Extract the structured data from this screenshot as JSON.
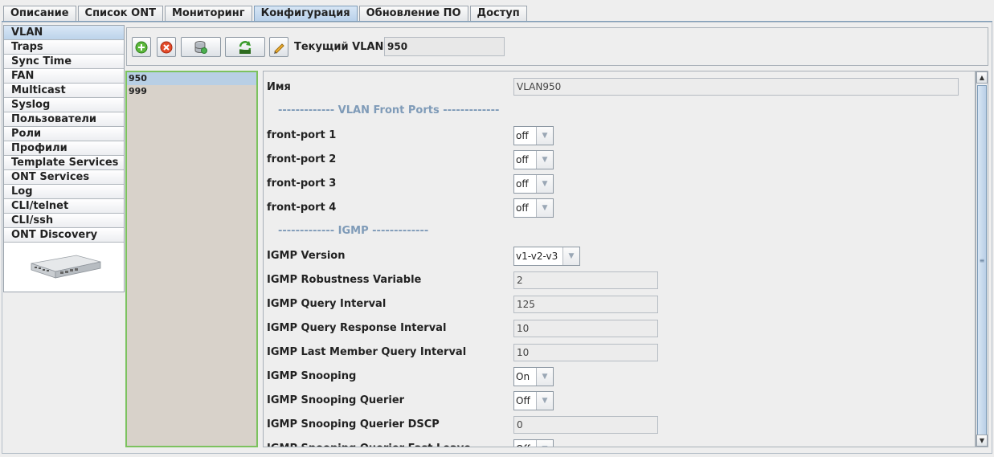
{
  "tabs": [
    {
      "label": "Описание"
    },
    {
      "label": "Список ONT"
    },
    {
      "label": "Мониторинг"
    },
    {
      "label": "Конфигурация"
    },
    {
      "label": "Обновление ПО"
    },
    {
      "label": "Доступ"
    }
  ],
  "active_tab": "Конфигурация",
  "sidebar": {
    "items": [
      {
        "label": "VLAN"
      },
      {
        "label": "Traps"
      },
      {
        "label": "Sync Time"
      },
      {
        "label": "FAN"
      },
      {
        "label": "Multicast"
      },
      {
        "label": "Syslog"
      },
      {
        "label": "Пользователи"
      },
      {
        "label": "Роли"
      },
      {
        "label": "Профили"
      },
      {
        "label": "Template Services"
      },
      {
        "label": "ONT Services"
      },
      {
        "label": "Log"
      },
      {
        "label": "CLI/telnet"
      },
      {
        "label": "CLI/ssh"
      },
      {
        "label": "ONT Discovery"
      }
    ],
    "device_image": "olt-device-image"
  },
  "toolbar": {
    "buttons": [
      "add-icon",
      "delete-icon",
      "database-icon",
      "vlan-refresh-icon",
      "pencil-icon"
    ],
    "current_vlan_label": "Текущий VLAN:",
    "current_vlan_value": "950"
  },
  "vlan_list": {
    "items": [
      "950",
      "999"
    ],
    "selected": "950"
  },
  "form": {
    "name_label": "Имя",
    "name_value": "VLAN950",
    "section_front_ports": "------------- VLAN Front Ports -------------",
    "front_ports": [
      {
        "label": "front-port 1",
        "value": "off"
      },
      {
        "label": "front-port 2",
        "value": "off"
      },
      {
        "label": "front-port 3",
        "value": "off"
      },
      {
        "label": "front-port 4",
        "value": "off"
      }
    ],
    "section_igmp": "------------- IGMP -------------",
    "igmp_version": {
      "label": "IGMP Version",
      "value": "v1-v2-v3"
    },
    "igmp_robustness": {
      "label": "IGMP Robustness Variable",
      "value": "2"
    },
    "igmp_query_interval": {
      "label": "IGMP Query Interval",
      "value": "125"
    },
    "igmp_query_response": {
      "label": "IGMP Query Response Interval",
      "value": "10"
    },
    "igmp_last_member": {
      "label": "IGMP Last Member Query Interval",
      "value": "10"
    },
    "igmp_snooping": {
      "label": "IGMP Snooping",
      "value": "On"
    },
    "igmp_snooping_querier": {
      "label": "IGMP Snooping Querier",
      "value": "Off"
    },
    "igmp_snooping_querier_dscp": {
      "label": "IGMP Snooping Querier DSCP",
      "value": "0"
    },
    "igmp_snooping_querier_partial": {
      "label": "IGMP Snooping Querier Fast Leave",
      "value": "Off"
    }
  },
  "colors": {
    "accent_tab": "#b9d1ea",
    "list_border": "#7cc25f",
    "list_bg": "#d8d2ca",
    "section_text": "#7f9bb8"
  }
}
